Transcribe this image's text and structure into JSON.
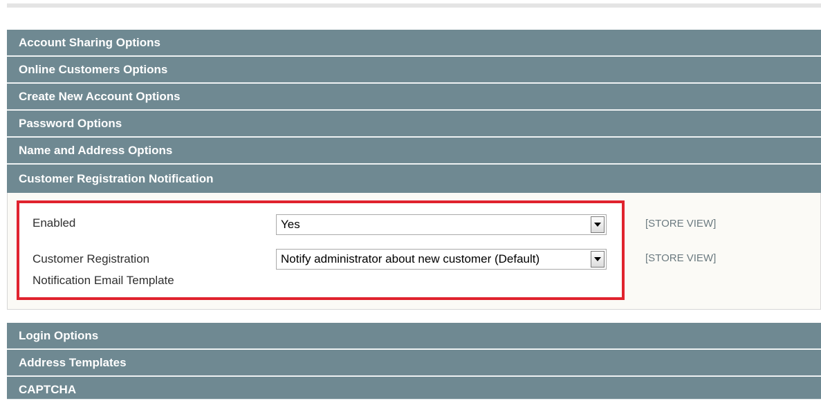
{
  "sections_above": [
    {
      "label": "Account Sharing Options"
    },
    {
      "label": "Online Customers Options"
    },
    {
      "label": "Create New Account Options"
    },
    {
      "label": "Password Options"
    },
    {
      "label": "Name and Address Options"
    },
    {
      "label": "Customer Registration Notification"
    }
  ],
  "fields": {
    "enabled": {
      "label": "Enabled",
      "value": "Yes",
      "scope": "[STORE VIEW]"
    },
    "template": {
      "label_line1": "Customer Registration",
      "label_line2": "Notification Email Template",
      "value": "Notify administrator about new customer (Default)",
      "scope": "[STORE VIEW]"
    }
  },
  "sections_below": [
    {
      "label": "Login Options"
    },
    {
      "label": "Address Templates"
    },
    {
      "label": "CAPTCHA"
    }
  ],
  "colors": {
    "header_bg": "#6f8992",
    "highlight_border": "#e0232e"
  }
}
